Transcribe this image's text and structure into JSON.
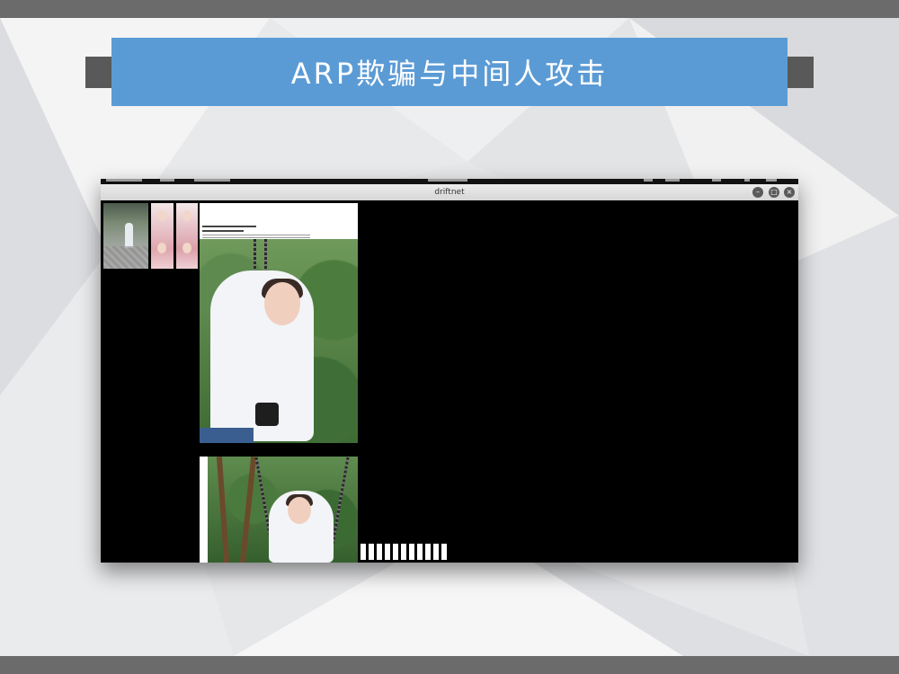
{
  "slide": {
    "title": "ARP欺骗与中间人攻击",
    "colors": {
      "title_bg": "#5b9bd5",
      "title_text": "#ffffff",
      "side_blocks": "#595959",
      "bands": "#6b6b6b"
    }
  },
  "window": {
    "title": "driftnet",
    "buttons": [
      {
        "name": "minimize",
        "glyph": "–"
      },
      {
        "name": "maximize",
        "glyph": "□"
      },
      {
        "name": "close",
        "glyph": "×"
      }
    ]
  },
  "captured_images": [
    {
      "name": "thumbnail-1"
    },
    {
      "name": "thumbnail-2"
    },
    {
      "name": "thumbnail-3"
    },
    {
      "name": "photo-swing-portrait"
    },
    {
      "name": "photo-swing-landscape"
    }
  ],
  "placeholder_strip_count": 11
}
